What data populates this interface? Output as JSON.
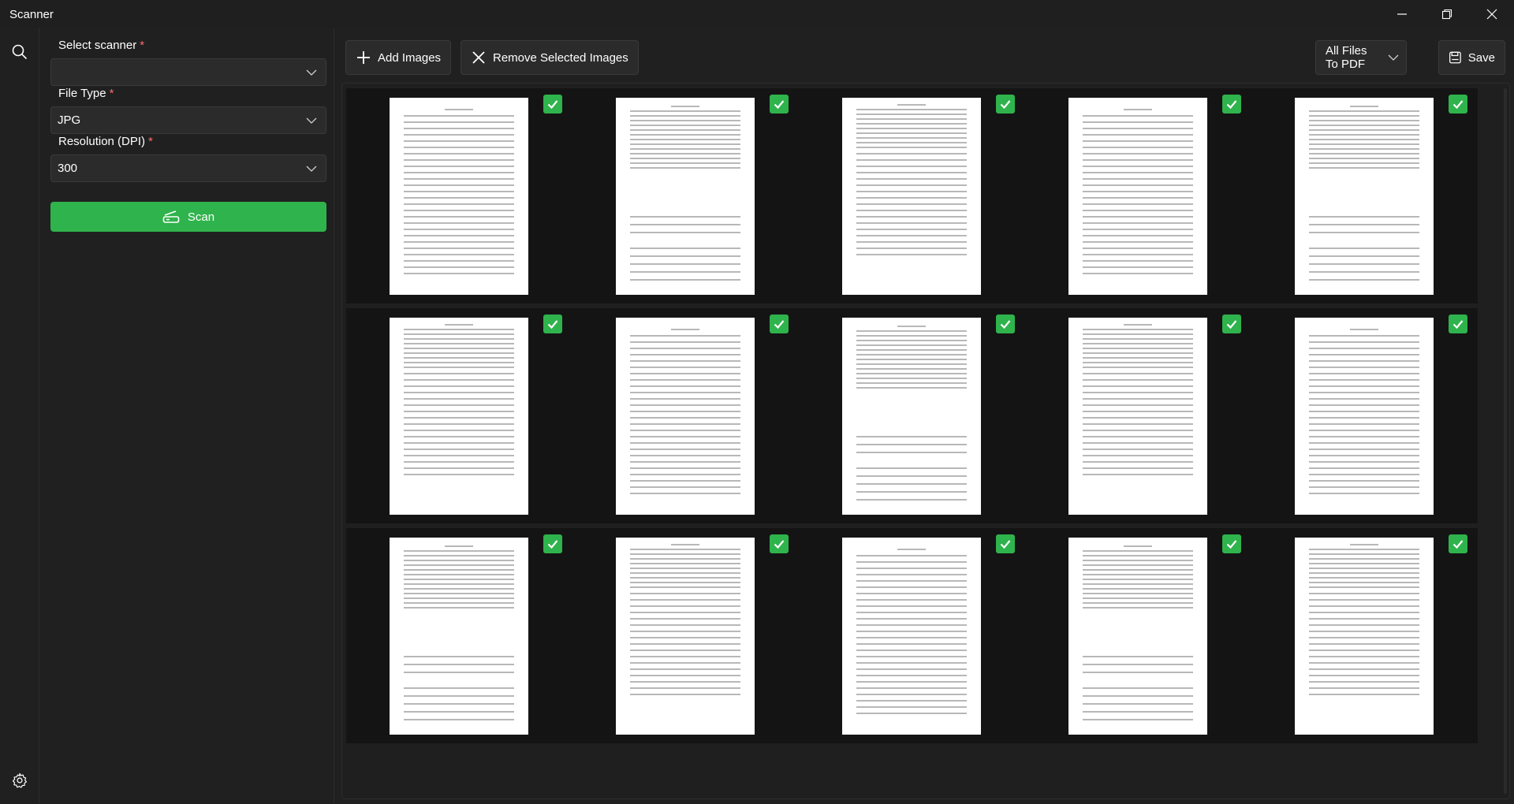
{
  "window": {
    "title": "Scanner",
    "controls": {
      "minimize_icon": "minimize-icon",
      "restore_icon": "restore-icon",
      "close_icon": "close-icon"
    }
  },
  "rail": {
    "search_icon": "search-icon",
    "settings_icon": "gear-icon"
  },
  "panel": {
    "scanner": {
      "label": "Select scanner",
      "required": "*",
      "value": ""
    },
    "file_type": {
      "label": "File Type",
      "required": "*",
      "value": "JPG"
    },
    "resolution": {
      "label": "Resolution (DPI)",
      "required": "*",
      "value": "300"
    },
    "scan_label": "Scan"
  },
  "toolbar": {
    "add_label": "Add Images",
    "remove_label": "Remove Selected Images",
    "convert_value": "All Files To PDF",
    "save_label": "Save"
  },
  "colors": {
    "accent": "#2fb34c",
    "required": "#ff6b6b",
    "background": "#202020",
    "cell": "#141414"
  },
  "images": [
    {
      "checked": true
    },
    {
      "checked": true
    },
    {
      "checked": true
    },
    {
      "checked": true
    },
    {
      "checked": true
    },
    {
      "checked": true
    },
    {
      "checked": true
    },
    {
      "checked": true
    },
    {
      "checked": true
    },
    {
      "checked": true
    },
    {
      "checked": true
    },
    {
      "checked": true
    },
    {
      "checked": true
    },
    {
      "checked": true
    },
    {
      "checked": true
    }
  ]
}
